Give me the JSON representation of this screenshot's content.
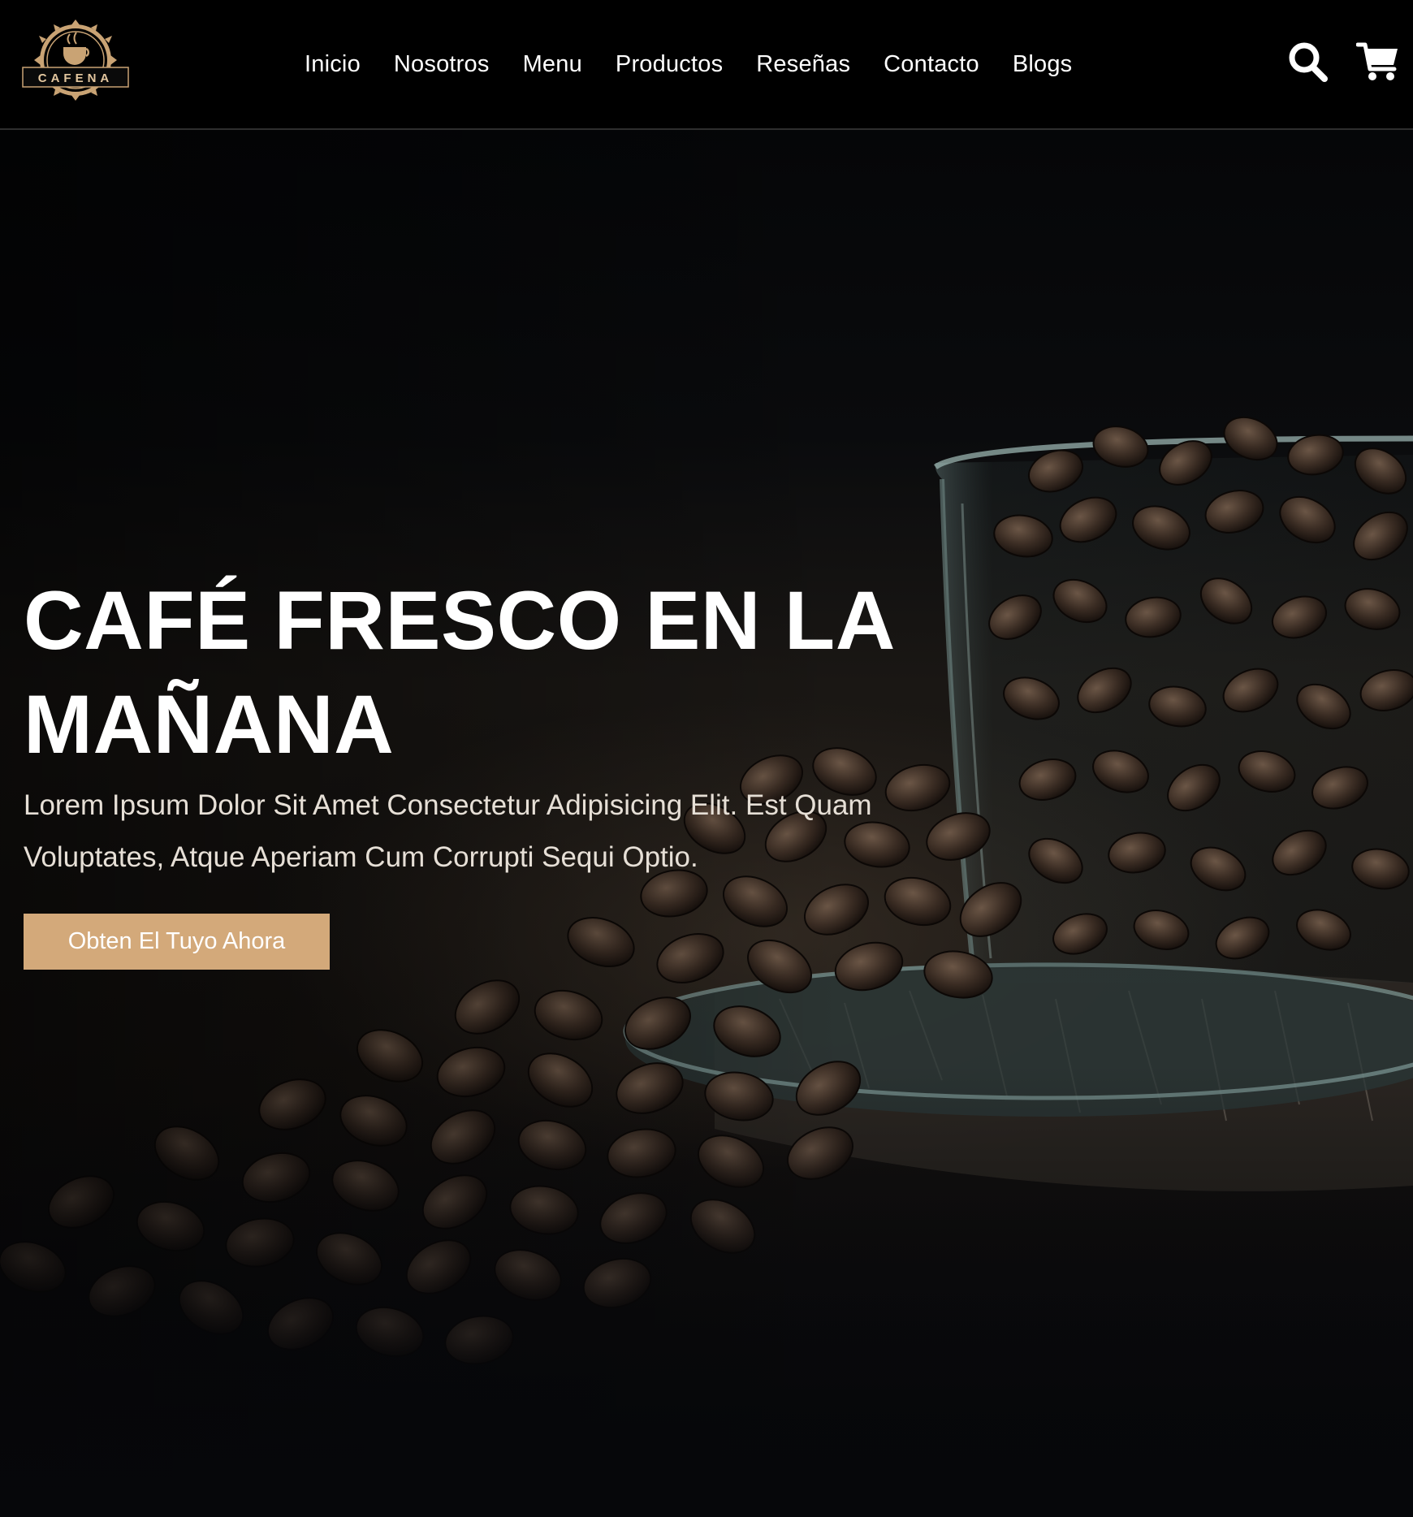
{
  "brand": {
    "name": "CAFENA",
    "accent_color": "#d3a97a",
    "logo_icon": "coffee-cup-badge-icon"
  },
  "nav": {
    "items": [
      {
        "label": "Inicio"
      },
      {
        "label": "Nosotros"
      },
      {
        "label": "Menu"
      },
      {
        "label": "Productos"
      },
      {
        "label": "Reseñas"
      },
      {
        "label": "Contacto"
      },
      {
        "label": "Blogs"
      }
    ],
    "search_icon": "search-icon",
    "cart_icon": "cart-icon"
  },
  "hero": {
    "title": "CAFÉ FRESCO EN LA MAÑANA",
    "text": "Lorem Ipsum Dolor Sit Amet Consectetur Adipisicing Elit. Est Quam Voluptates, Atque Aperiam Cum Corrupti Sequi Optio.",
    "cta_label": "Obten El Tuyo Ahora",
    "background_image": "coffee beans in glass cup"
  }
}
